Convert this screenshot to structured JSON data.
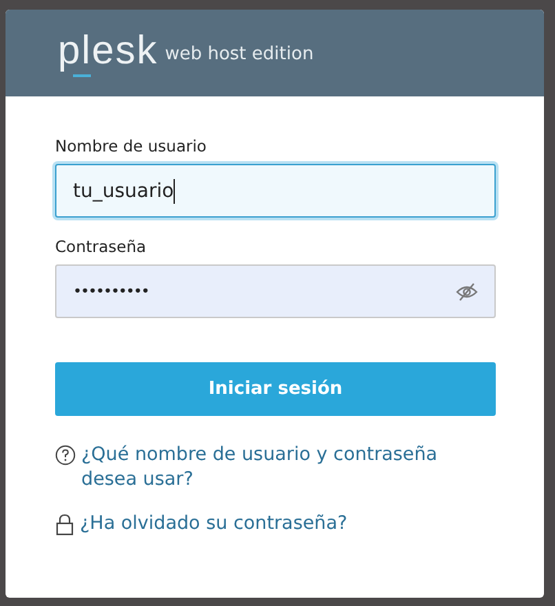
{
  "header": {
    "logo": "plesk",
    "edition": "web host edition"
  },
  "fields": [
    {
      "label": "Nombre de usuario",
      "value": "tu_usuario",
      "kind": "text",
      "focused": true
    },
    {
      "label": "Contraseña",
      "value": "••••••••••",
      "kind": "password",
      "focused": false
    }
  ],
  "submit": "Iniciar sesión",
  "links": [
    {
      "kind": "help",
      "text": "¿Qué nombre de usuario y contraseña desea usar?"
    },
    {
      "kind": "lock",
      "text": "¿Ha olvidado su contraseña?"
    }
  ]
}
